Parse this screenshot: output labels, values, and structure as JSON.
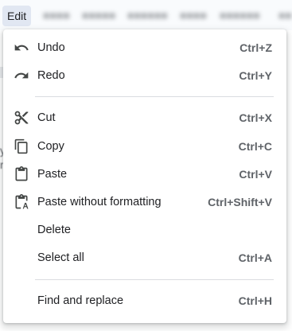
{
  "menubar": {
    "active_menu": "Edit"
  },
  "edit_menu": {
    "items": [
      {
        "label": "Undo",
        "shortcut": "Ctrl+Z",
        "icon": "undo-icon"
      },
      {
        "label": "Redo",
        "shortcut": "Ctrl+Y",
        "icon": "redo-icon"
      },
      {
        "label": "Cut",
        "shortcut": "Ctrl+X",
        "icon": "scissors-icon"
      },
      {
        "label": "Copy",
        "shortcut": "Ctrl+C",
        "icon": "copy-icon"
      },
      {
        "label": "Paste",
        "shortcut": "Ctrl+V",
        "icon": "clipboard-icon"
      },
      {
        "label": "Paste without formatting",
        "shortcut": "Ctrl+Shift+V",
        "icon": "clipboard-plain-icon"
      },
      {
        "label": "Delete",
        "shortcut": ""
      },
      {
        "label": "Select all",
        "shortcut": "Ctrl+A"
      },
      {
        "label": "Find and replace",
        "shortcut": "Ctrl+H"
      }
    ]
  },
  "colors": {
    "menu_highlight": "#e1e7f2",
    "menubar_bg": "#f9fbfd",
    "text": "#202124",
    "shortcut_text": "#5f6368",
    "separator": "#dadce0",
    "icon": "#444746"
  }
}
